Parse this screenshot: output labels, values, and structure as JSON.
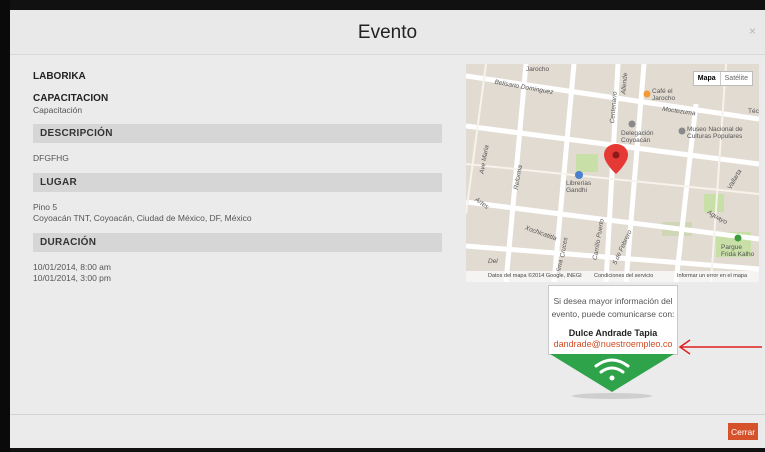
{
  "modal": {
    "title": "Evento",
    "close_symbol": "×"
  },
  "event": {
    "organization": "LABORIKA",
    "category": "CAPACITACION",
    "subcategory": "Capacitación",
    "description_label": "DESCRIPCIÓN",
    "description": "DFGFHG",
    "location_label": "LUGAR",
    "location_line1": "Pino 5",
    "location_line2": "Coyoacán TNT, Coyoacán, Ciudad de México, DF, México",
    "duration_label": "DURACIÓN",
    "start": "10/01/2014, 8:00 am",
    "end": "10/01/2014, 3:00 pm"
  },
  "map": {
    "type_map": "Mapa",
    "type_satellite": "Satélite",
    "footer_data": "Datos del mapa ©2014 Google, INEGI",
    "footer_terms": "Condiciones del servicio",
    "footer_report": "Informar un error en el mapa",
    "labels": {
      "jarocho_top": "Jarocho",
      "cafe": "Café el Jarocho",
      "tec": "Téc",
      "museo": "Museo Nacional de Culturas Populares",
      "delegacion": "Delegación Coyoacán",
      "librerias": "Librerías Gandhi",
      "pargue": "Pargue Frida Kalho",
      "street_belisario": "Belisario Dominguez",
      "street_centenario": "Centenario",
      "street_allende": "Allende",
      "street_moctezuma": "Moctezuma",
      "street_ave_maria": "Ave Maria",
      "street_reforma": "Reforma",
      "street_artes": "Artes",
      "street_xochicatitla": "Xochicatitla",
      "street_cruces": "Cruces",
      "street_carrillo_puerto": "Carrillo Puerto",
      "street_5_de_febrero": "5 de Febrero",
      "street_aguayo": "Aguayo",
      "street_vallarta": "Vallarta",
      "street_olima": "olima",
      "street_del": "Del"
    }
  },
  "contact": {
    "message_line1": "Si desea mayor información del",
    "message_line2": "evento, puede comunicarse con:",
    "name": "Dulce Andrade Tapia",
    "email": "dandrade@nuestroempleo.co"
  },
  "footer": {
    "close_label": "Cerrar"
  },
  "colors": {
    "accent": "#d6522b",
    "badge_green": "#2ea34a",
    "arrow_red": "#e02020",
    "marker_red": "#e53935"
  }
}
